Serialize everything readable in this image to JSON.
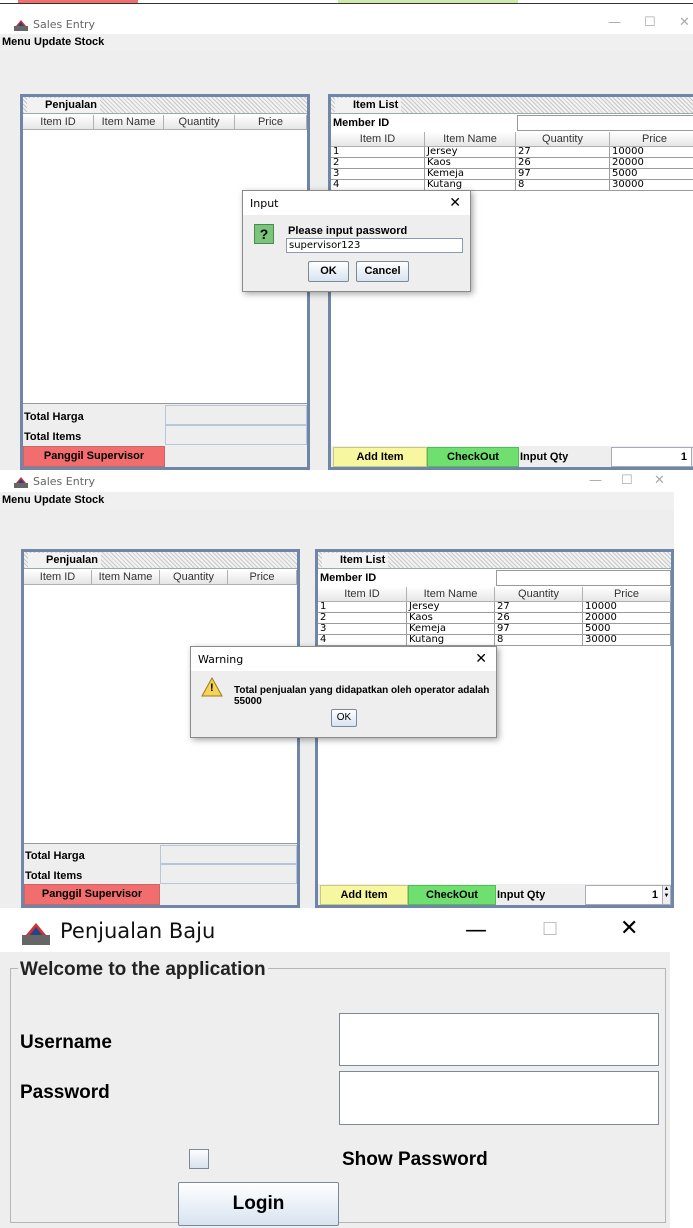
{
  "screen1": {
    "window_title": "Sales Entry",
    "menu": [
      "Menu",
      "Update Stock"
    ],
    "penjualan": {
      "title": "Penjualan",
      "columns": [
        "Item ID",
        "Item Name",
        "Quantity",
        "Price"
      ],
      "total_harga_label": "Total Harga",
      "total_items_label": "Total Items",
      "supervisor_button": "Panggil Supervisor"
    },
    "item_list": {
      "title": "Item List",
      "member_id_label": "Member ID",
      "columns": [
        "Item ID",
        "Item Name",
        "Quantity",
        "Price"
      ],
      "rows": [
        [
          "1",
          "Jersey",
          "27",
          "10000"
        ],
        [
          "2",
          "Kaos",
          "26",
          "20000"
        ],
        [
          "3",
          "Kemeja",
          "97",
          "5000"
        ],
        [
          "4",
          "Kutang",
          "8",
          "30000"
        ]
      ],
      "add_item_button": "Add Item",
      "checkout_button": "CheckOut",
      "input_qty_label": "Input Qty",
      "qty_value": "1"
    },
    "dialog": {
      "title": "Input",
      "close_glyph": "✕",
      "icon_glyph": "?",
      "message": "Please input password",
      "input_value": "supervisor123",
      "ok": "OK",
      "cancel": "Cancel"
    }
  },
  "screen2": {
    "window_title": "Sales Entry",
    "menu": [
      "Menu",
      "Update Stock"
    ],
    "penjualan": {
      "title": "Penjualan",
      "columns": [
        "Item ID",
        "Item Name",
        "Quantity",
        "Price"
      ],
      "total_harga_label": "Total Harga",
      "total_items_label": "Total Items",
      "supervisor_button": "Panggil Supervisor"
    },
    "item_list": {
      "title": "Item List",
      "member_id_label": "Member ID",
      "columns": [
        "Item ID",
        "Item Name",
        "Quantity",
        "Price"
      ],
      "rows": [
        [
          "1",
          "Jersey",
          "27",
          "10000"
        ],
        [
          "2",
          "Kaos",
          "26",
          "20000"
        ],
        [
          "3",
          "Kemeja",
          "97",
          "5000"
        ],
        [
          "4",
          "Kutang",
          "8",
          "30000"
        ]
      ],
      "add_item_button": "Add Item",
      "checkout_button": "CheckOut",
      "input_qty_label": "Input Qty",
      "qty_value": "1"
    },
    "dialog": {
      "title": "Warning",
      "close_glyph": "✕",
      "icon_glyph": "!",
      "message": "Total penjualan yang didapatkan oleh operator adalah 55000",
      "ok": "OK"
    }
  },
  "screen3": {
    "window_title": "Penjualan Baju",
    "minimize_glyph": "—",
    "maximize_glyph": "☐",
    "close_glyph": "✕",
    "group_title": "Welcome to the application",
    "username_label": "Username",
    "username_value": "",
    "password_label": "Password",
    "password_value": "",
    "show_password_label": "Show Password",
    "login_button": "Login"
  }
}
